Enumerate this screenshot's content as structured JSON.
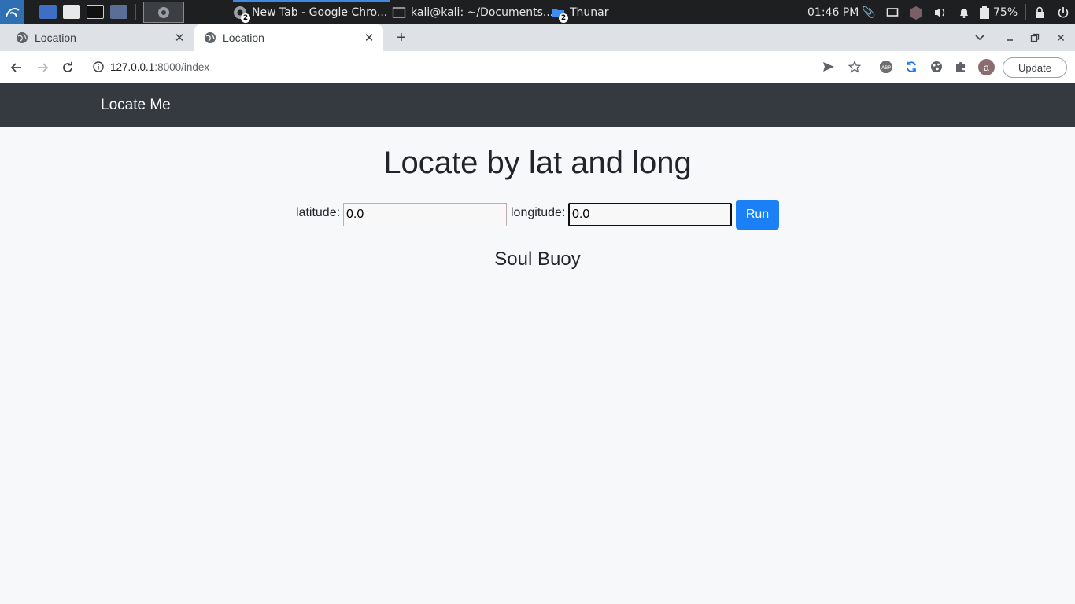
{
  "taskbar": {
    "tasks": [
      {
        "label": "New Tab - Google Chro...",
        "badge": "2"
      },
      {
        "label": "kali@kali: ~/Documents..."
      },
      {
        "label": "Thunar",
        "badge": "2"
      }
    ],
    "clock": "01:46 PM",
    "battery": "75%"
  },
  "browser": {
    "tabs": [
      {
        "title": "Location"
      },
      {
        "title": "Location"
      }
    ],
    "url_host": "127.0.0.1",
    "url_rest": ":8000/index",
    "profile_initial": "a",
    "update_label": "Update"
  },
  "page": {
    "brand": "Locate Me",
    "title": "Locate by lat and long",
    "latitude_label": "latitude:",
    "latitude_value": "0.0",
    "longitude_label": "longitude:",
    "longitude_value": "0.0",
    "run_label": "Run",
    "result": "Soul Buoy"
  },
  "colors": {
    "navbar": "#343a40",
    "button": "#1b7ff5",
    "page_bg": "#f7f8f9"
  }
}
